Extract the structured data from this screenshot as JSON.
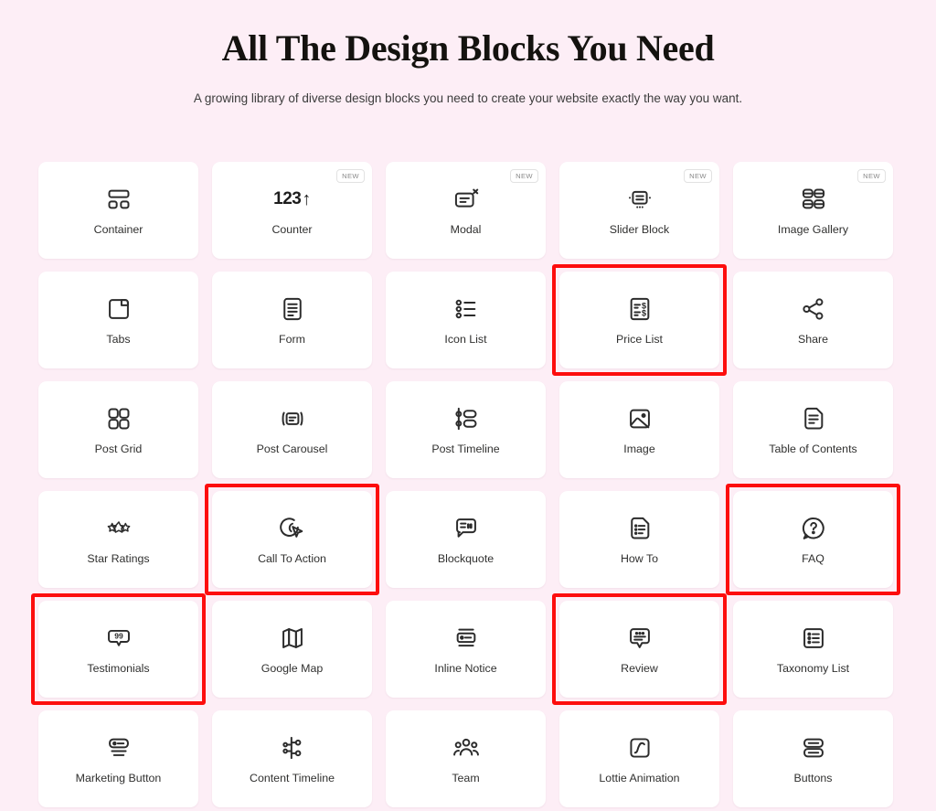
{
  "header": {
    "title": "All The Design Blocks You Need",
    "subtitle": "A growing library of diverse design blocks you need to create your website exactly the way you want."
  },
  "badges": {
    "new_label": "NEW"
  },
  "colors": {
    "background": "#fdeef6",
    "card": "#ffffff",
    "highlight": "#fd0d0d",
    "text": "#30302f",
    "title": "#14120f"
  },
  "blocks": [
    {
      "label": "Container",
      "icon": "container-icon",
      "new": false,
      "highlighted": false
    },
    {
      "label": "Counter",
      "icon": "counter-icon",
      "new": true,
      "highlighted": false
    },
    {
      "label": "Modal",
      "icon": "modal-icon",
      "new": true,
      "highlighted": false
    },
    {
      "label": "Slider Block",
      "icon": "slider-block-icon",
      "new": true,
      "highlighted": false
    },
    {
      "label": "Image Gallery",
      "icon": "image-gallery-icon",
      "new": true,
      "highlighted": false
    },
    {
      "label": "Tabs",
      "icon": "tabs-icon",
      "new": false,
      "highlighted": false
    },
    {
      "label": "Form",
      "icon": "form-icon",
      "new": false,
      "highlighted": false
    },
    {
      "label": "Icon List",
      "icon": "icon-list-icon",
      "new": false,
      "highlighted": false
    },
    {
      "label": "Price List",
      "icon": "price-list-icon",
      "new": false,
      "highlighted": true
    },
    {
      "label": "Share",
      "icon": "share-icon",
      "new": false,
      "highlighted": false
    },
    {
      "label": "Post Grid",
      "icon": "post-grid-icon",
      "new": false,
      "highlighted": false
    },
    {
      "label": "Post Carousel",
      "icon": "post-carousel-icon",
      "new": false,
      "highlighted": false
    },
    {
      "label": "Post Timeline",
      "icon": "post-timeline-icon",
      "new": false,
      "highlighted": false
    },
    {
      "label": "Image",
      "icon": "image-icon",
      "new": false,
      "highlighted": false
    },
    {
      "label": "Table of Contents",
      "icon": "table-of-contents-icon",
      "new": false,
      "highlighted": false
    },
    {
      "label": "Star Ratings",
      "icon": "star-ratings-icon",
      "new": false,
      "highlighted": false
    },
    {
      "label": "Call To Action",
      "icon": "call-to-action-icon",
      "new": false,
      "highlighted": true
    },
    {
      "label": "Blockquote",
      "icon": "blockquote-icon",
      "new": false,
      "highlighted": false
    },
    {
      "label": "How To",
      "icon": "how-to-icon",
      "new": false,
      "highlighted": false
    },
    {
      "label": "FAQ",
      "icon": "faq-icon",
      "new": false,
      "highlighted": true
    },
    {
      "label": "Testimonials",
      "icon": "testimonials-icon",
      "new": false,
      "highlighted": true
    },
    {
      "label": "Google Map",
      "icon": "google-map-icon",
      "new": false,
      "highlighted": false
    },
    {
      "label": "Inline Notice",
      "icon": "inline-notice-icon",
      "new": false,
      "highlighted": false
    },
    {
      "label": "Review",
      "icon": "review-icon",
      "new": false,
      "highlighted": true
    },
    {
      "label": "Taxonomy List",
      "icon": "taxonomy-list-icon",
      "new": false,
      "highlighted": false
    },
    {
      "label": "Marketing Button",
      "icon": "marketing-button-icon",
      "new": false,
      "highlighted": false
    },
    {
      "label": "Content Timeline",
      "icon": "content-timeline-icon",
      "new": false,
      "highlighted": false
    },
    {
      "label": "Team",
      "icon": "team-icon",
      "new": false,
      "highlighted": false
    },
    {
      "label": "Lottie Animation",
      "icon": "lottie-animation-icon",
      "new": false,
      "highlighted": false
    },
    {
      "label": "Buttons",
      "icon": "buttons-icon",
      "new": false,
      "highlighted": false
    }
  ],
  "counter_icon_text": {
    "number": "123",
    "arrow": "↑"
  },
  "testimonial_icon_text": {
    "quote_number": "99"
  }
}
